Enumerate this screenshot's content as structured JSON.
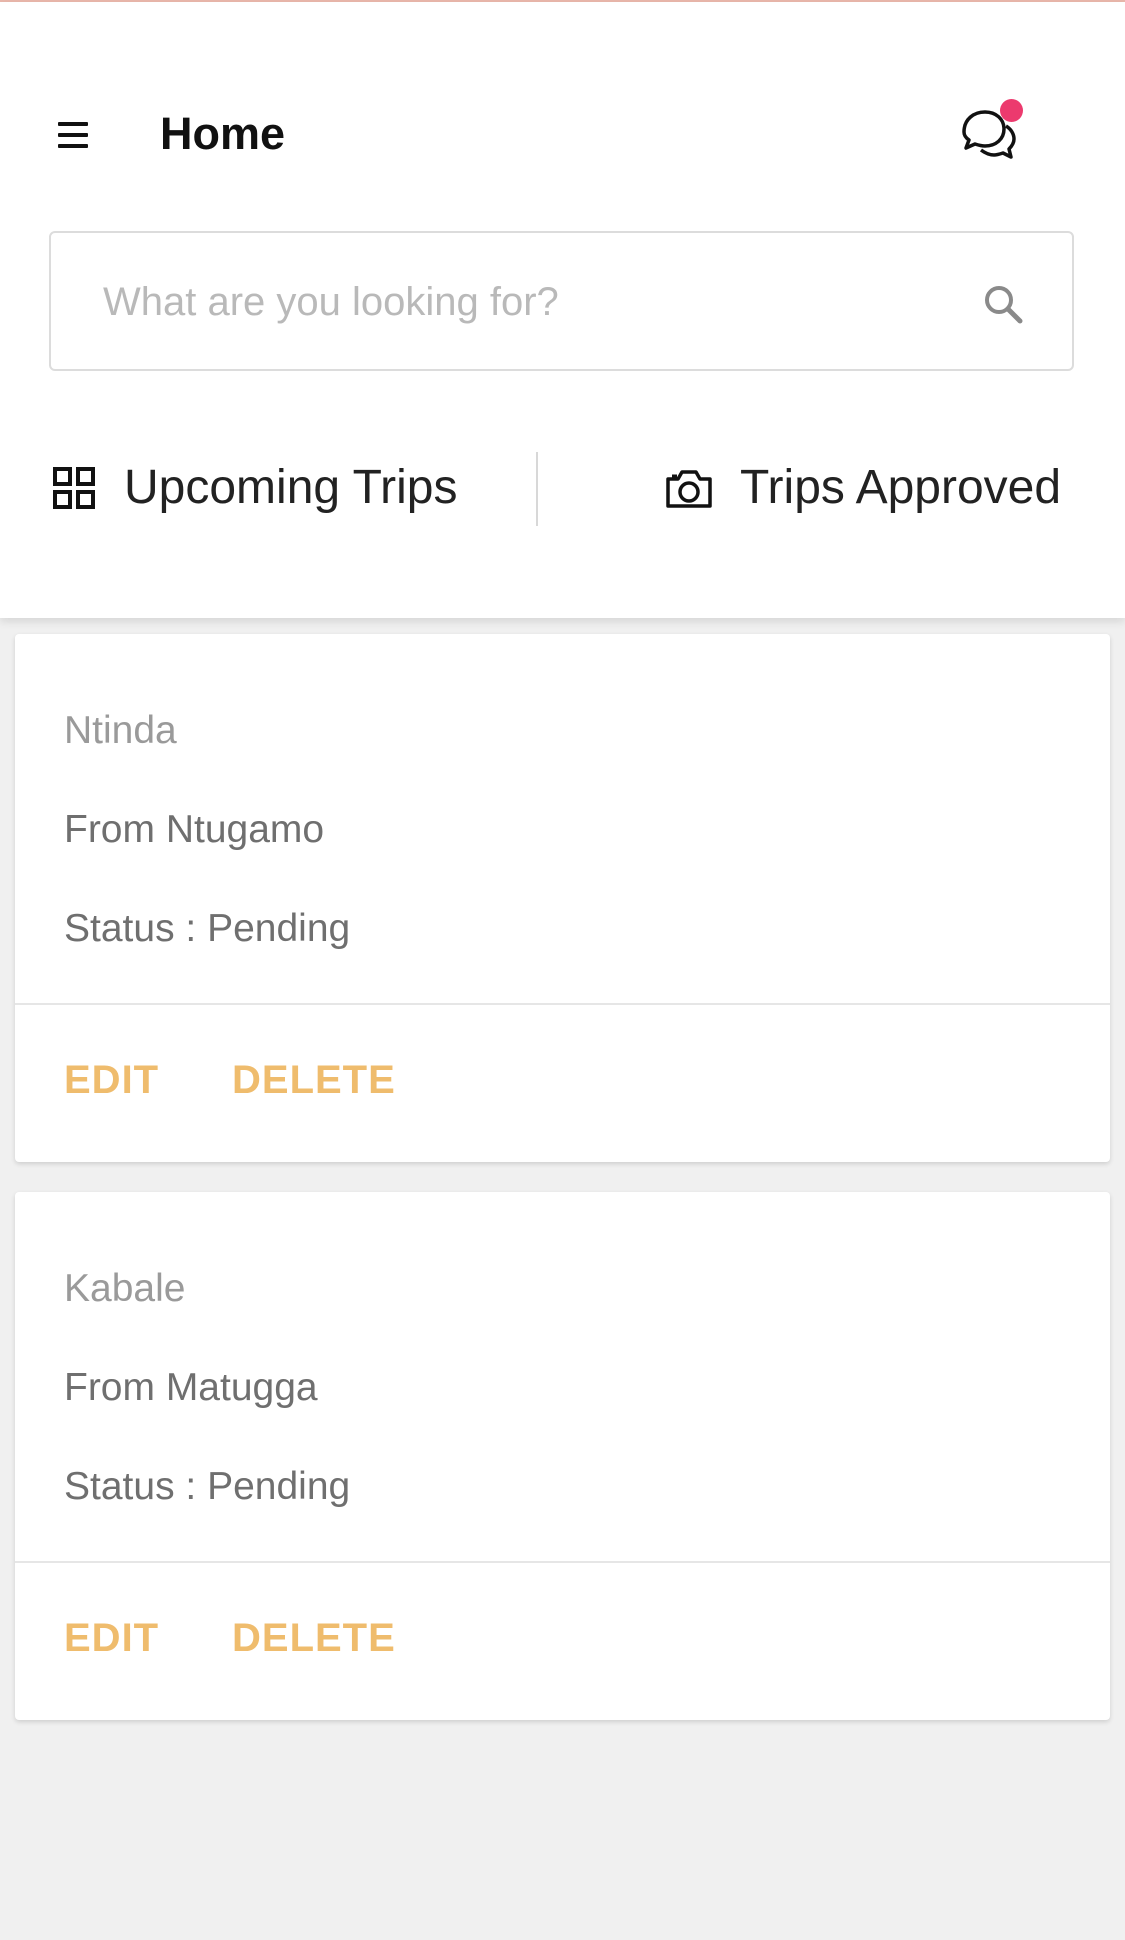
{
  "header": {
    "title": "Home",
    "menu_icon": "menu-icon",
    "chat_icon": "chat-bubbles-icon",
    "notification_color": "#ec3a6e"
  },
  "search": {
    "placeholder": "What are you looking for?",
    "value": "",
    "icon": "search-icon"
  },
  "tabs": [
    {
      "label": "Upcoming Trips",
      "icon": "grid-icon"
    },
    {
      "label": "Trips Approved",
      "icon": "camera-icon"
    }
  ],
  "trips": [
    {
      "destination": "Ntinda",
      "from": "From Ntugamo",
      "status": "Status : Pending",
      "edit_label": "EDIT",
      "delete_label": "DELETE"
    },
    {
      "destination": "Kabale",
      "from": "From Matugga",
      "status": "Status : Pending",
      "edit_label": "EDIT",
      "delete_label": "DELETE"
    }
  ],
  "colors": {
    "accent": "#efbc6d",
    "background": "#f0f0f0",
    "card": "#ffffff"
  }
}
